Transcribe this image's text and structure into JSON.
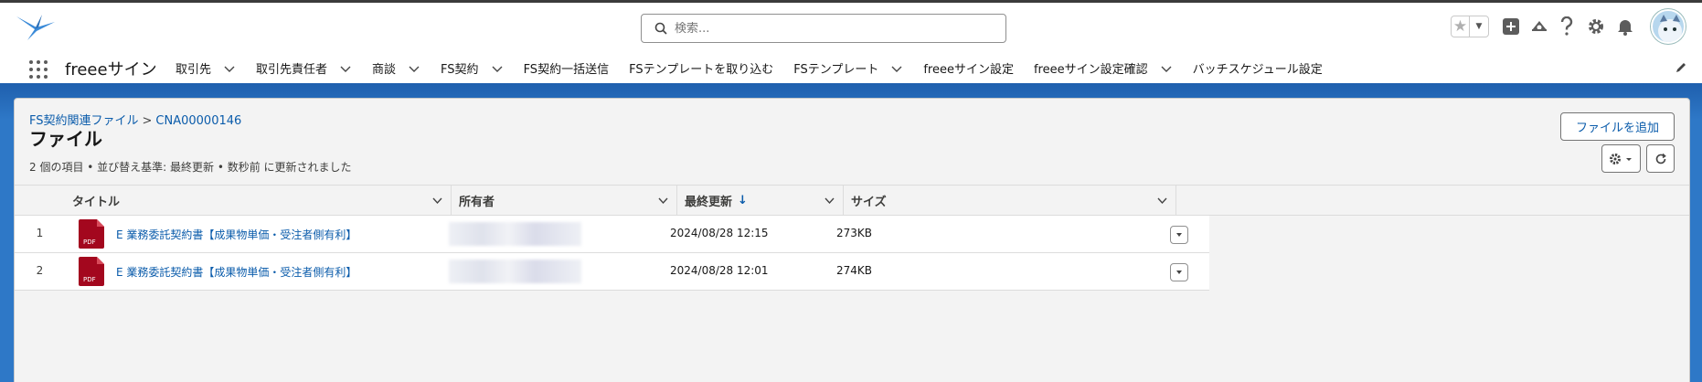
{
  "header": {
    "search_placeholder": "検索...",
    "app_name": "freeeサイン",
    "nav_items": [
      {
        "label": "取引先",
        "dropdown": true
      },
      {
        "label": "取引先責任者",
        "dropdown": true
      },
      {
        "label": "商談",
        "dropdown": true
      },
      {
        "label": "FS契約",
        "dropdown": true
      },
      {
        "label": "FS契約一括送信",
        "dropdown": false
      },
      {
        "label": "FSテンプレートを取り込む",
        "dropdown": false
      },
      {
        "label": "FSテンプレート",
        "dropdown": true
      },
      {
        "label": "freeeサイン設定",
        "dropdown": false
      },
      {
        "label": "freeeサイン設定確認",
        "dropdown": true
      },
      {
        "label": "バッチスケジュール設定",
        "dropdown": false
      }
    ],
    "utility_icons": [
      "favorites-star-icon",
      "add-icon",
      "trailhead-icon",
      "help-icon",
      "setup-gear-icon",
      "notification-bell-icon"
    ]
  },
  "page": {
    "breadcrumb_parent": "FS契約関連ファイル",
    "breadcrumb_separator": ">",
    "breadcrumb_record": "CNA00000146",
    "title": "ファイル",
    "meta": "2 個の項目 • 並び替え基準: 最終更新 • 数秒前 に更新されました",
    "add_file_label": "ファイルを追加"
  },
  "table": {
    "columns": [
      "タイトル",
      "所有者",
      "最終更新",
      "サイズ"
    ],
    "sort_indicator": "↓",
    "rows": [
      {
        "num": "1",
        "title": "E 業務委託契約書【成果物単価・受注者側有利】",
        "date": "2024/08/28 12:15",
        "size": "273KB"
      },
      {
        "num": "2",
        "title": "E 業務委託契約書【成果物単価・受注者側有利】",
        "date": "2024/08/28 12:01",
        "size": "274KB"
      }
    ]
  },
  "colors": {
    "accent": "#0b5cab",
    "band": "#2e78c7",
    "pdf_red": "#a3071e"
  }
}
